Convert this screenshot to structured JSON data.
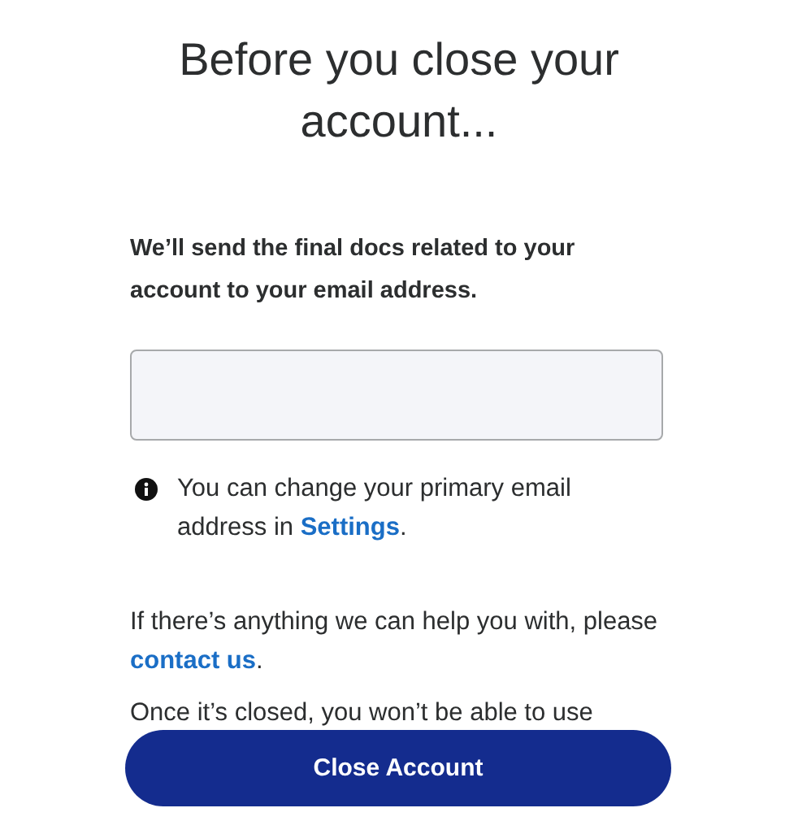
{
  "title": "Before you close your account...",
  "intro": "We’ll send the final docs related to your account to your email address.",
  "email_field": {
    "kind": "masked"
  },
  "info_note": {
    "text": "You can change your primary email address in ",
    "link": "Settings",
    "end": "."
  },
  "help_note": {
    "text": "If there’s anything we can help you with, please ",
    "link": "contact us",
    "end": "."
  },
  "warning": "Once it’s closed, you won’t be able to use",
  "primary_button": "Close Account"
}
